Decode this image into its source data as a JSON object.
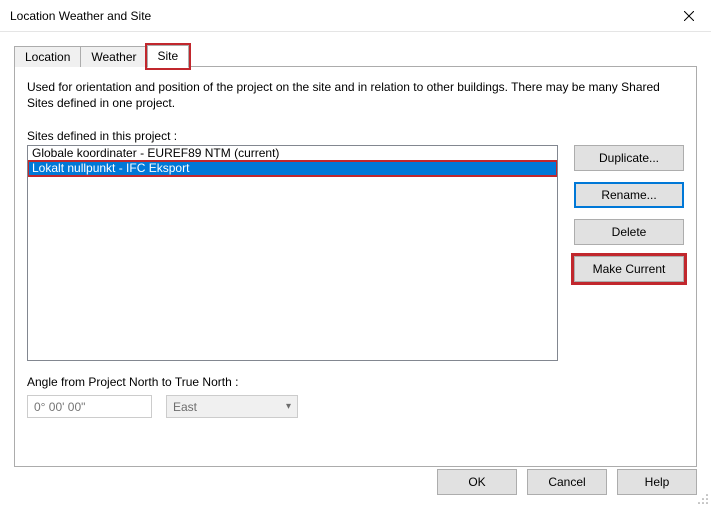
{
  "window": {
    "title": "Location Weather and Site"
  },
  "tabs": {
    "location": "Location",
    "weather": "Weather",
    "site": "Site"
  },
  "intro_text": "Used for orientation and position of the project on the site and in relation to other buildings. There may be many Shared Sites defined in one project.",
  "sites": {
    "label": "Sites defined in this project :",
    "items": [
      {
        "label": "Globale koordinater - EUREF89 NTM (current)",
        "selected": false
      },
      {
        "label": "Lokalt nullpunkt - IFC Eksport",
        "selected": true
      }
    ]
  },
  "buttons": {
    "duplicate": "Duplicate...",
    "rename": "Rename...",
    "delete": "Delete",
    "make_current": "Make Current"
  },
  "angle": {
    "label": "Angle from Project North to True North :",
    "value_placeholder": "0° 00' 00\"",
    "direction": "East"
  },
  "footer": {
    "ok": "OK",
    "cancel": "Cancel",
    "help": "Help"
  }
}
